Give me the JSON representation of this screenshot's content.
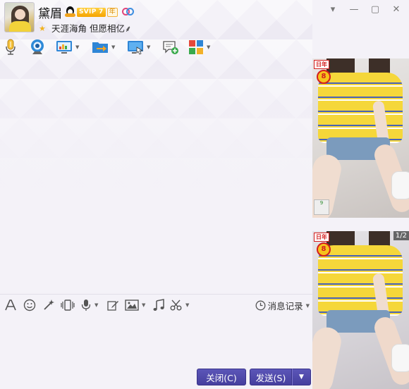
{
  "contact": {
    "nickname": "黛眉",
    "vip_badge": "SVIP 7",
    "year_badge": "年",
    "signature": "天涯海角 但愿相亿⸙"
  },
  "window": {
    "controls": [
      "dropdown",
      "minimize",
      "maximize",
      "close"
    ]
  },
  "toolbar": {
    "items": [
      {
        "name": "voice-call",
        "icon": "microphone-icon"
      },
      {
        "name": "video-call",
        "icon": "webcam-icon"
      },
      {
        "name": "remote-assist",
        "icon": "screen-chart-icon",
        "has_menu": true
      },
      {
        "name": "send-file",
        "icon": "folder-arrow-icon",
        "has_menu": true
      },
      {
        "name": "screen-share",
        "icon": "monitor-icon",
        "has_menu": true
      },
      {
        "name": "create-discussion",
        "icon": "chat-add-icon"
      },
      {
        "name": "apps",
        "icon": "apps-grid-icon",
        "has_menu": true
      }
    ]
  },
  "input_toolbar": {
    "items": [
      {
        "name": "font",
        "icon": "font-icon"
      },
      {
        "name": "emoji",
        "icon": "smiley-icon"
      },
      {
        "name": "magic",
        "icon": "magic-wand-icon"
      },
      {
        "name": "shake",
        "icon": "shake-icon"
      },
      {
        "name": "voice-msg",
        "icon": "mic-icon",
        "has_menu": true
      },
      {
        "name": "edit",
        "icon": "edit-icon"
      },
      {
        "name": "image",
        "icon": "image-icon",
        "has_menu": true
      },
      {
        "name": "music",
        "icon": "music-icon"
      },
      {
        "name": "screenshot",
        "icon": "scissors-icon",
        "has_menu": true
      }
    ],
    "history_label": "消息记录"
  },
  "buttons": {
    "close_label": "关闭(C)",
    "send_label": "发送(S)"
  },
  "side_panel": {
    "stamp_text": "日年",
    "badge_number": "8",
    "corner_badge": "9",
    "page_indicator": "1/2"
  },
  "colors": {
    "button": "#4b45a6",
    "stripe_yellow": "#f5d73a",
    "stripe_blue": "#4a63b5"
  }
}
